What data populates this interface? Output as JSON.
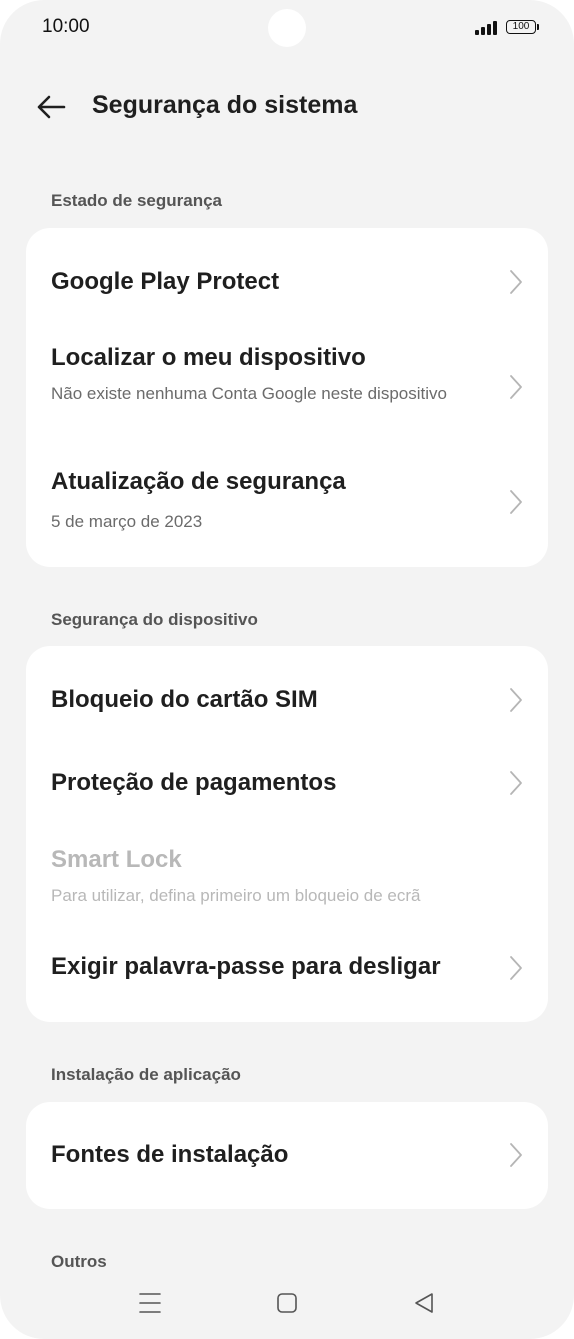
{
  "status": {
    "time": "10:00",
    "battery": "100"
  },
  "header": {
    "title": "Segurança do sistema"
  },
  "sections": {
    "security_state": {
      "label": "Estado de segurança",
      "items": [
        {
          "title": "Google Play Protect"
        },
        {
          "title": "Localizar o meu dispositivo",
          "subtitle": "Não existe nenhuma Conta Google neste dispositivo"
        },
        {
          "title": "Atualização de segurança",
          "subtitle": "5 de março de 2023"
        }
      ]
    },
    "device_security": {
      "label": "Segurança do dispositivo",
      "items": [
        {
          "title": "Bloqueio do cartão SIM"
        },
        {
          "title": "Proteção de pagamentos"
        },
        {
          "title": "Smart Lock",
          "subtitle": "Para utilizar, defina primeiro um bloqueio de ecrã"
        },
        {
          "title": "Exigir palavra-passe para desligar"
        }
      ]
    },
    "app_install": {
      "label": "Instalação de aplicação",
      "items": [
        {
          "title": "Fontes de instalação"
        }
      ]
    },
    "others": {
      "label": "Outros"
    }
  },
  "icons": {
    "back": "arrow-left-icon",
    "chevron": "chevron-right-icon",
    "nav_menu": "menu-icon",
    "nav_home": "home-square-icon",
    "nav_back": "back-triangle-icon"
  },
  "colors": {
    "background": "#f3f3f3",
    "card": "#ffffff",
    "disabled_text": "#b8b8b8"
  }
}
